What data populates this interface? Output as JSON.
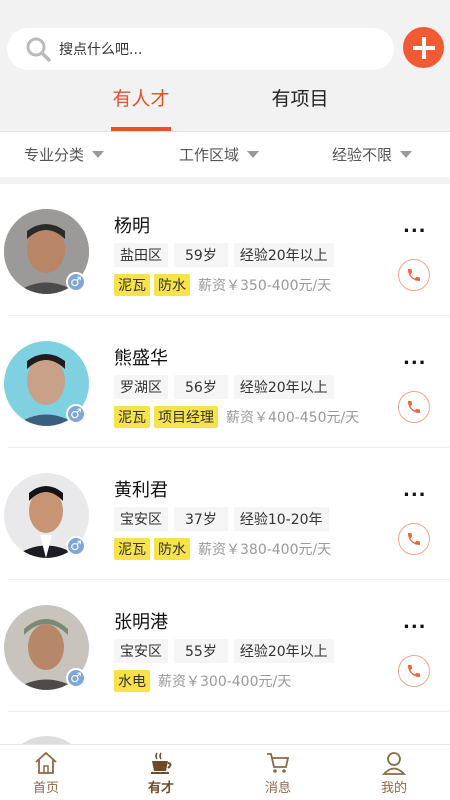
{
  "search": {
    "placeholder": "搜点什么吧..."
  },
  "tabs": [
    {
      "label": "有人才",
      "active": true
    },
    {
      "label": "有项目",
      "active": false
    }
  ],
  "filters": [
    {
      "label": "专业分类"
    },
    {
      "label": "工作区域"
    },
    {
      "label": "经验不限"
    }
  ],
  "people": [
    {
      "name": "杨明",
      "district": "盐田区",
      "age": "59岁",
      "experience": "经验20年以上",
      "tags": [
        "泥瓦",
        "防水"
      ],
      "salary": "薪资￥350-400元/天",
      "gender": "♂"
    },
    {
      "name": "熊盛华",
      "district": "罗湖区",
      "age": "56岁",
      "experience": "经验20年以上",
      "tags": [
        "泥瓦",
        "项目经理"
      ],
      "salary": "薪资￥400-450元/天",
      "gender": "♂"
    },
    {
      "name": "黄利君",
      "district": "宝安区",
      "age": "37岁",
      "experience": "经验10-20年",
      "tags": [
        "泥瓦",
        "防水"
      ],
      "salary": "薪资￥380-400元/天",
      "gender": "♂"
    },
    {
      "name": "张明港",
      "district": "宝安区",
      "age": "55岁",
      "experience": "经验20年以上",
      "tags": [
        "水电"
      ],
      "salary": "薪资￥300-400元/天",
      "gender": "♂"
    }
  ],
  "more_label": "...",
  "nav": [
    {
      "label": "首页",
      "icon": "home-icon"
    },
    {
      "label": "有才",
      "icon": "coffee-icon",
      "active": true
    },
    {
      "label": "消息",
      "icon": "cart-icon"
    },
    {
      "label": "我的",
      "icon": "user-icon"
    }
  ],
  "colors": {
    "accent": "#e8502a",
    "tag": "#f7e24a",
    "nav": "#8a6a47"
  }
}
